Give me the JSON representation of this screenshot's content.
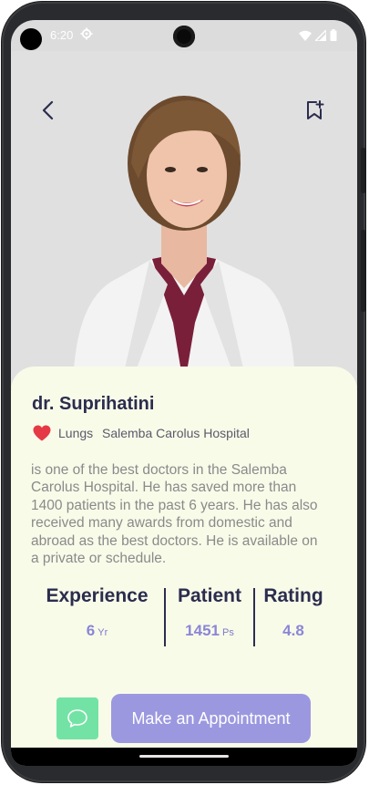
{
  "status_bar": {
    "time": "6:20"
  },
  "doctor": {
    "name": "dr. Suprihatini",
    "specialty": "Lungs",
    "hospital": "Salemba Carolus Hospital",
    "bio": "is one of the best doctors in the Salemba Carolus Hospital. He has saved more than 1400 patients in the past 6 years. He has also received many awards from domestic and abroad as the best doctors. He is available on a private or schedule."
  },
  "stats": {
    "experience": {
      "title": "Experience",
      "value": "6",
      "unit": "Yr"
    },
    "patient": {
      "title": "Patient",
      "value": "1451",
      "unit": "Ps"
    },
    "rating": {
      "title": "Rating",
      "value": "4.8"
    }
  },
  "actions": {
    "appointment_label": "Make an Appointment"
  },
  "icons": {
    "back": "chevron-left-icon",
    "bookmark": "bookmark-add-icon",
    "favorite": "heart-icon",
    "chat": "chat-bubble-icon"
  },
  "colors": {
    "accent": "#9b98e0",
    "chat_button": "#72e3a4",
    "card_background": "#f9fbe9",
    "heading": "#2b2d4e",
    "heart": "#e63946"
  }
}
